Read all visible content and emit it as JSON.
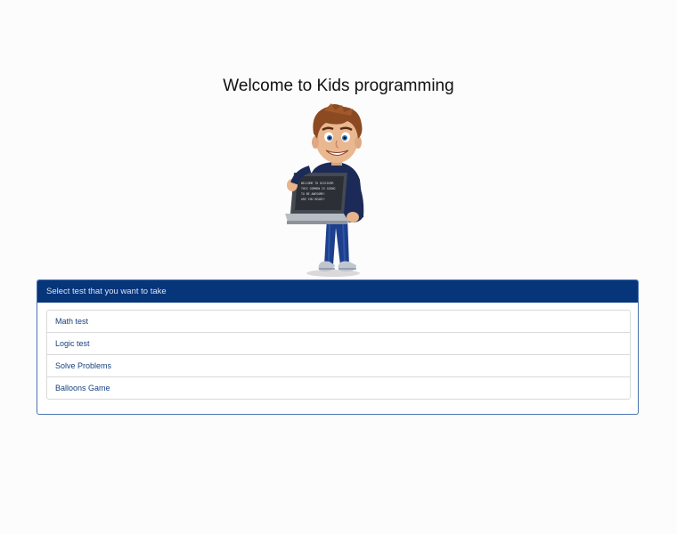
{
  "page": {
    "title": "Welcome to Kids programming"
  },
  "mascot": {
    "laptop_screen_lines": [
      "WELCOME TO DISCOVER",
      "THIS COMMON IS GOING",
      "TO BE AWESOME!",
      "ARE YOU READY!"
    ]
  },
  "test_panel": {
    "heading": "Select test that you want to take",
    "items": [
      {
        "label": "Math test"
      },
      {
        "label": "Logic test"
      },
      {
        "label": "Solve Problems"
      },
      {
        "label": "Balloons Game"
      }
    ]
  },
  "colors": {
    "panel_heading_bg": "#06357a",
    "link": "#17407f",
    "panel_border": "#4a72b0"
  }
}
